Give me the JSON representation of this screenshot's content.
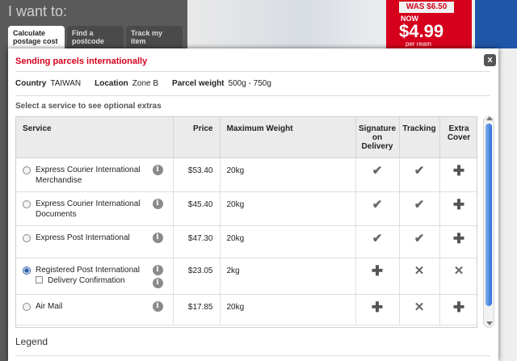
{
  "background": {
    "heading": "I want to:",
    "tabs": [
      {
        "label": "Calculate postage cost",
        "active": true
      },
      {
        "label": "Find a postcode",
        "active": false
      },
      {
        "label": "Track my item",
        "active": false
      }
    ],
    "promo": {
      "was": "WAS $6.50",
      "now": "NOW",
      "price": "$4.99",
      "unit": "per ream"
    }
  },
  "dialog": {
    "title": "Sending parcels internationally",
    "close_label": "x",
    "details": {
      "country_label": "Country",
      "country_value": "TAIWAN",
      "location_label": "Location",
      "location_value": "Zone B",
      "weight_label": "Parcel weight",
      "weight_value": "500g - 750g"
    },
    "hint": "Select a service to see optional extras",
    "columns": [
      "Service",
      "Price",
      "Maximum Weight",
      "Signature on Delivery",
      "Tracking",
      "Extra Cover"
    ],
    "rows": [
      {
        "service": "Express Courier International Merchandise",
        "price": "$53.40",
        "max_weight": "20kg",
        "signature": "check",
        "tracking": "check",
        "extra_cover": "plus",
        "selected": false
      },
      {
        "service": "Express Courier International Documents",
        "price": "$45.40",
        "max_weight": "20kg",
        "signature": "check",
        "tracking": "check",
        "extra_cover": "plus",
        "selected": false
      },
      {
        "service": "Express Post International",
        "price": "$47.30",
        "max_weight": "20kg",
        "signature": "check",
        "tracking": "check",
        "extra_cover": "plus",
        "selected": false
      },
      {
        "service": "Registered Post International",
        "option": "Delivery Confirmation",
        "price": "$23.05",
        "max_weight": "2kg",
        "signature": "plus",
        "tracking": "cross",
        "extra_cover": "cross",
        "selected": true
      },
      {
        "service": "Air Mail",
        "price": "$17.85",
        "max_weight": "20kg",
        "signature": "plus",
        "tracking": "cross",
        "extra_cover": "plus",
        "selected": false
      }
    ],
    "legend": "Legend"
  },
  "icons": {
    "check": "✔",
    "plus": "✚",
    "cross": "✕",
    "info": "i"
  }
}
